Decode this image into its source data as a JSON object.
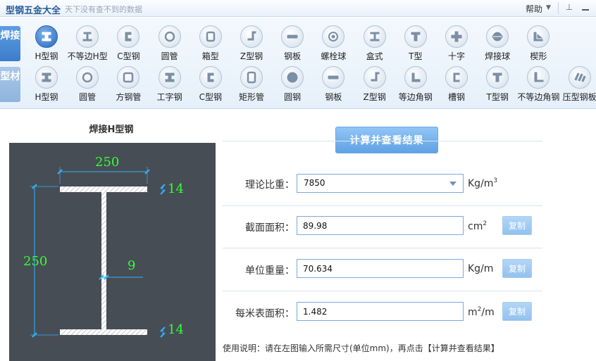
{
  "app": {
    "title": "型钢五金大全",
    "slogan": "天下没有查不到的数据",
    "help_label": "帮助"
  },
  "categories": [
    {
      "label": "焊接",
      "active": true
    },
    {
      "label": "型材",
      "active": false
    }
  ],
  "welded_items": [
    {
      "label": "H型钢",
      "icon": "h-beam-icon"
    },
    {
      "label": "不等边H型",
      "icon": "unequal-h-icon"
    },
    {
      "label": "C型钢",
      "icon": "c-channel-icon"
    },
    {
      "label": "圆管",
      "icon": "round-tube-icon"
    },
    {
      "label": "箱型",
      "icon": "box-section-icon"
    },
    {
      "label": "Z型钢",
      "icon": "z-section-icon"
    },
    {
      "label": "钢板",
      "icon": "steel-plate-icon"
    },
    {
      "label": "螺栓球",
      "icon": "bolt-ball-icon"
    },
    {
      "label": "盒式",
      "icon": "box-type-icon"
    },
    {
      "label": "T型",
      "icon": "t-section-icon"
    },
    {
      "label": "十字",
      "icon": "cross-section-icon"
    },
    {
      "label": "焊接球",
      "icon": "welded-ball-icon"
    },
    {
      "label": "楔形",
      "icon": "wedge-icon"
    }
  ],
  "profile_items": [
    {
      "label": "H型钢",
      "icon": "h-beam-icon"
    },
    {
      "label": "圆管",
      "icon": "round-tube-icon"
    },
    {
      "label": "方钢管",
      "icon": "square-tube-icon"
    },
    {
      "label": "工字钢",
      "icon": "i-beam-icon"
    },
    {
      "label": "C型钢",
      "icon": "c-channel-icon"
    },
    {
      "label": "矩形管",
      "icon": "rect-tube-icon"
    },
    {
      "label": "圆钢",
      "icon": "round-bar-icon"
    },
    {
      "label": "钢板",
      "icon": "steel-plate-icon"
    },
    {
      "label": "Z型钢",
      "icon": "z-section-icon"
    },
    {
      "label": "等边角钢",
      "icon": "equal-angle-icon"
    },
    {
      "label": "槽钢",
      "icon": "channel-icon"
    },
    {
      "label": "T型钢",
      "icon": "t-section-icon"
    },
    {
      "label": "不等边角钢",
      "icon": "unequal-angle-icon"
    },
    {
      "label": "压型钢板",
      "icon": "profiled-sheet-icon"
    }
  ],
  "diagram": {
    "title": "焊接H型钢",
    "flange_width": "250",
    "height": "250",
    "web_thickness": "9",
    "top_flange_thickness": "14",
    "bottom_flange_thickness": "14"
  },
  "calc_button_label": "计算并查看结果",
  "copy_label": "复制",
  "rows": [
    {
      "label": "理论比重：",
      "value": "7850",
      "unit": "Kg/m",
      "unit_sup": "3"
    },
    {
      "label": "截面面积：",
      "value": "89.98",
      "unit": "cm",
      "unit_sup": "2"
    },
    {
      "label": "单位重量：",
      "value": "70.634",
      "unit": "Kg/m",
      "unit_sup": ""
    },
    {
      "label": "每米表面积：",
      "value": "1.482",
      "unit": "m",
      "unit_sup": "2",
      "unit_suffix": "/m"
    }
  ],
  "usage_note": "使用说明：请在左图输入所需尺寸(单位mm)，再点击【计算并查看结果】",
  "colors": {
    "accent": "#3f7fcc",
    "diagram_bg": "#474d55",
    "dimension_text": "#33ff33"
  }
}
